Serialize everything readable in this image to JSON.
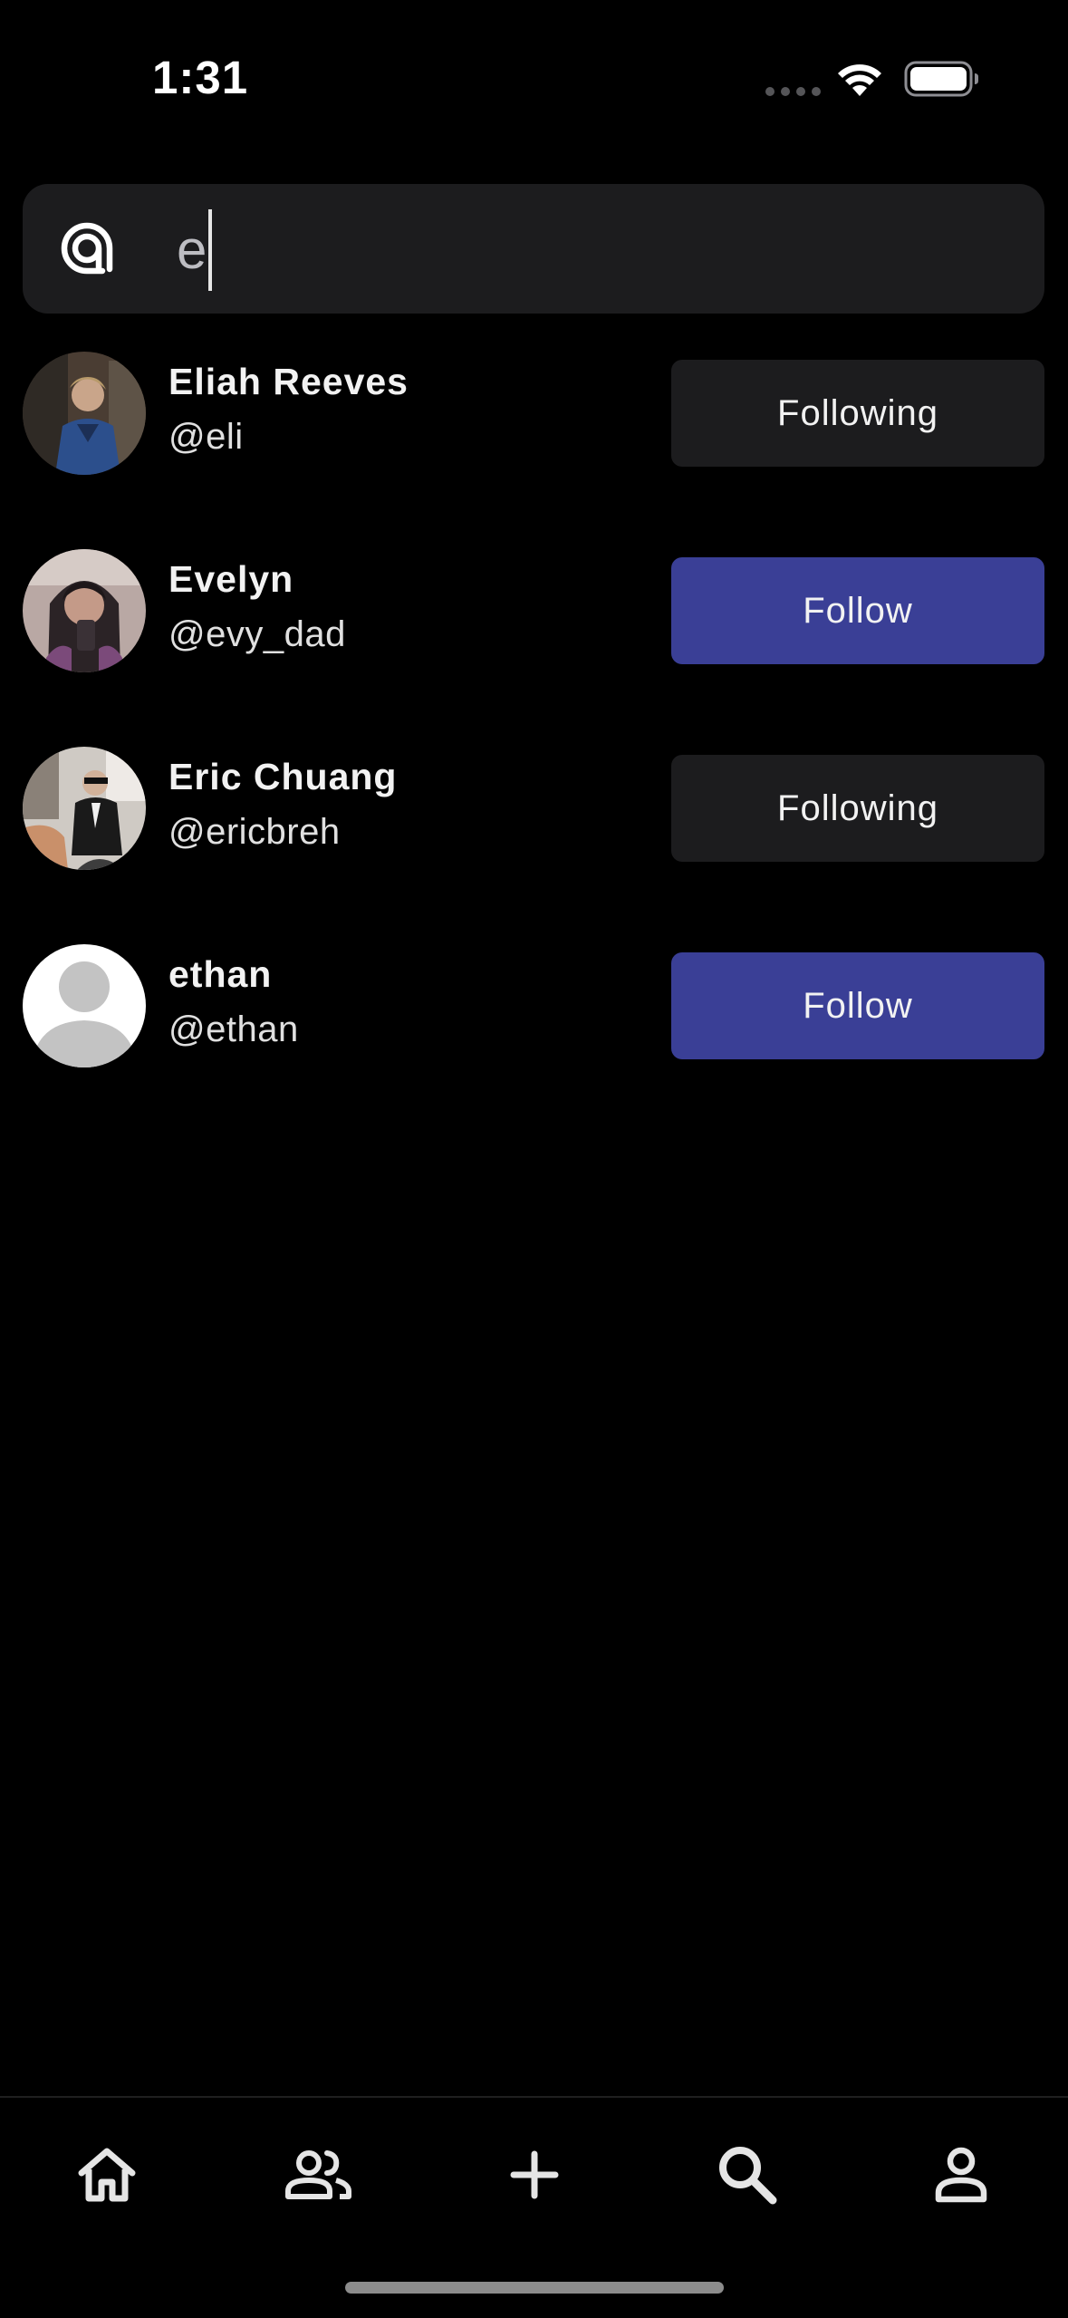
{
  "status_bar": {
    "time": "1:31"
  },
  "search": {
    "value": "e",
    "icon": "at-sign-icon"
  },
  "users": [
    {
      "name": "Eliah Reeves",
      "handle": "@eli",
      "button_label": "Following",
      "state": "following",
      "avatar": "photo"
    },
    {
      "name": "Evelyn",
      "handle": "@evy_dad",
      "button_label": "Follow",
      "state": "follow",
      "avatar": "photo"
    },
    {
      "name": "Eric Chuang",
      "handle": "@ericbreh",
      "button_label": "Following",
      "state": "following",
      "avatar": "photo"
    },
    {
      "name": "ethan",
      "handle": "@ethan",
      "button_label": "Follow",
      "state": "follow",
      "avatar": "default-person"
    }
  ],
  "tab_bar": {
    "tabs": [
      {
        "icon": "home-icon"
      },
      {
        "icon": "people-icon"
      },
      {
        "icon": "plus-icon"
      },
      {
        "icon": "search-icon"
      },
      {
        "icon": "profile-icon"
      }
    ]
  },
  "colors": {
    "background": "#000000",
    "surface": "#1c1c1e",
    "follow_button": "#3a3f96",
    "text": "#f2f2f2"
  }
}
